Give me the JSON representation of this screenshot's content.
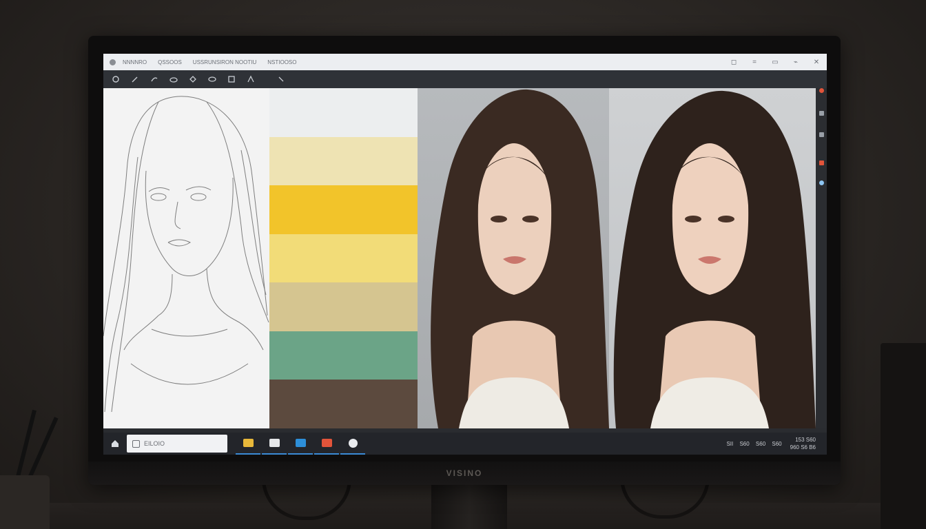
{
  "window": {
    "menu": [
      "NNNNRO",
      "QSSOOS",
      "USSRUNSIRON NOOTIU",
      "NSTIOOSO"
    ],
    "controls": [
      "◻",
      "=",
      "▭",
      "⌁",
      "✕"
    ]
  },
  "toolbar": {
    "tools": [
      "pin-icon",
      "pencil-icon",
      "brush-icon",
      "cloud-icon",
      "eraser-icon",
      "pen-icon",
      "frame-icon",
      "fill-icon",
      "picker-icon"
    ]
  },
  "palette": {
    "colors": [
      "#eceeef",
      "#eee3b3",
      "#f2c42a",
      "#f2dc78",
      "#d5c590",
      "#6ba487",
      "#5c4a3e"
    ]
  },
  "taskbar": {
    "search_text": "EILOIO",
    "apps": [
      {
        "name": "file-manager",
        "color": "#e8b83a"
      },
      {
        "name": "notes",
        "color": "#e6e8ea"
      },
      {
        "name": "browser",
        "color": "#2d8fd9"
      },
      {
        "name": "store",
        "color": "#e2543a"
      },
      {
        "name": "chrome",
        "color": "#e9ebee"
      }
    ],
    "tray": [
      "SII",
      "S60",
      "S60",
      "S60"
    ],
    "clock_line1": "153 S60",
    "clock_line2": "960 S6 B6"
  },
  "monitor": {
    "brand": "VISINO"
  }
}
